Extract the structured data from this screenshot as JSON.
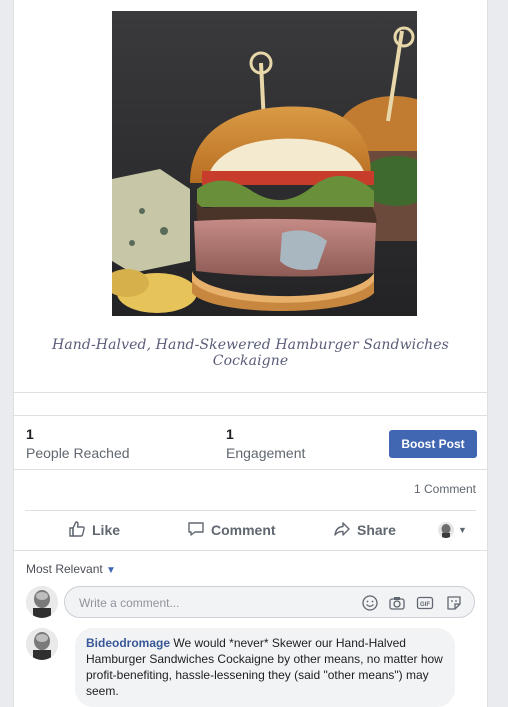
{
  "post": {
    "caption": "Hand-Halved, Hand-Skewered Hamburger Sandwiches Cockaigne",
    "image_icon": "hamburger-photo"
  },
  "stats": {
    "reach_value": "1",
    "reach_label": "People Reached",
    "engagement_value": "1",
    "engagement_label": "Engagement",
    "boost_label": "Boost Post"
  },
  "counts": {
    "comments": "1 Comment"
  },
  "actions": {
    "like": "Like",
    "comment": "Comment",
    "share": "Share"
  },
  "comments_section": {
    "sort_label": "Most Relevant",
    "input_placeholder": "Write a comment...",
    "comments": [
      {
        "author": "Bideodromage",
        "text": "We would *never* Skewer our Hand-Halved Hamburger Sandwiches Cockaigne by other means, no matter how profit-benefiting, hassle-lessening they (said \"other means\") may seem."
      }
    ]
  },
  "colors": {
    "accent": "#4267b2",
    "link": "#385898",
    "background": "#e9ebee"
  }
}
